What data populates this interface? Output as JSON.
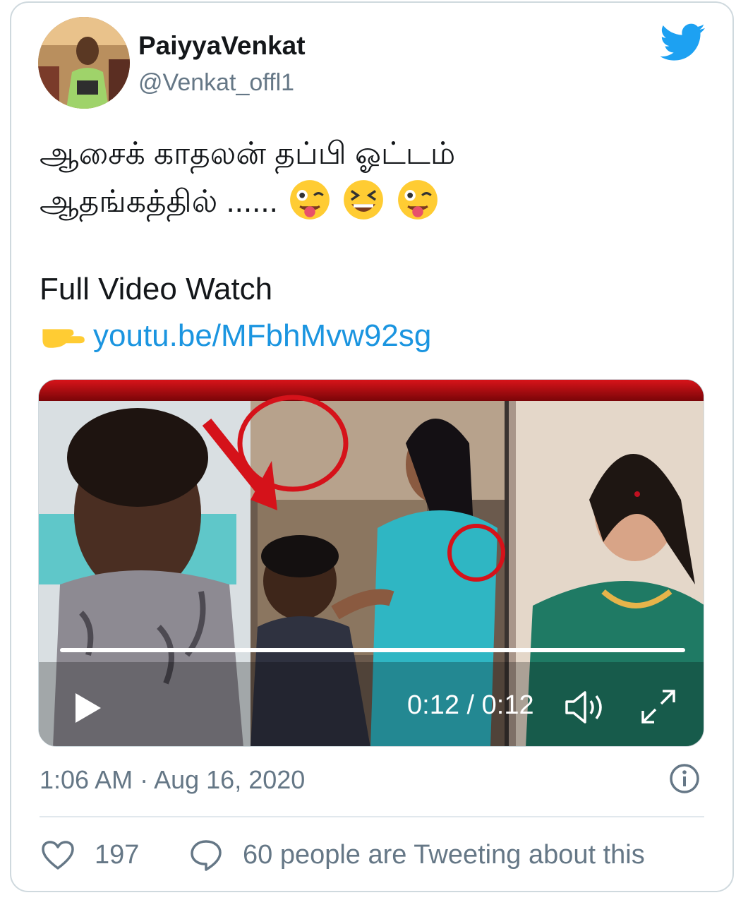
{
  "user": {
    "name": "PaiyyaVenkat",
    "handle": "@Venkat_offl1"
  },
  "tweet": {
    "line1": "ஆசைக் காதலன் தப்பி ஓட்டம்",
    "line2": "ஆதங்கத்தில் ......",
    "emoji_set": [
      "face-with-tongue-winking",
      "grinning-squinting-face",
      "face-with-tongue-winking"
    ],
    "line3": "Full Video Watch",
    "link": "youtu.be/MFbhMvw92sg"
  },
  "video": {
    "time": "0:12 / 0:12",
    "progress": 1.0
  },
  "meta": {
    "timestamp": "1:06 AM · Aug 16, 2020"
  },
  "stats": {
    "likes": "197",
    "tweeting": "60 people are Tweeting about this"
  },
  "colors": {
    "link": "#1b95e0",
    "twitter_blue": "#1da1f2",
    "muted": "#657786"
  }
}
